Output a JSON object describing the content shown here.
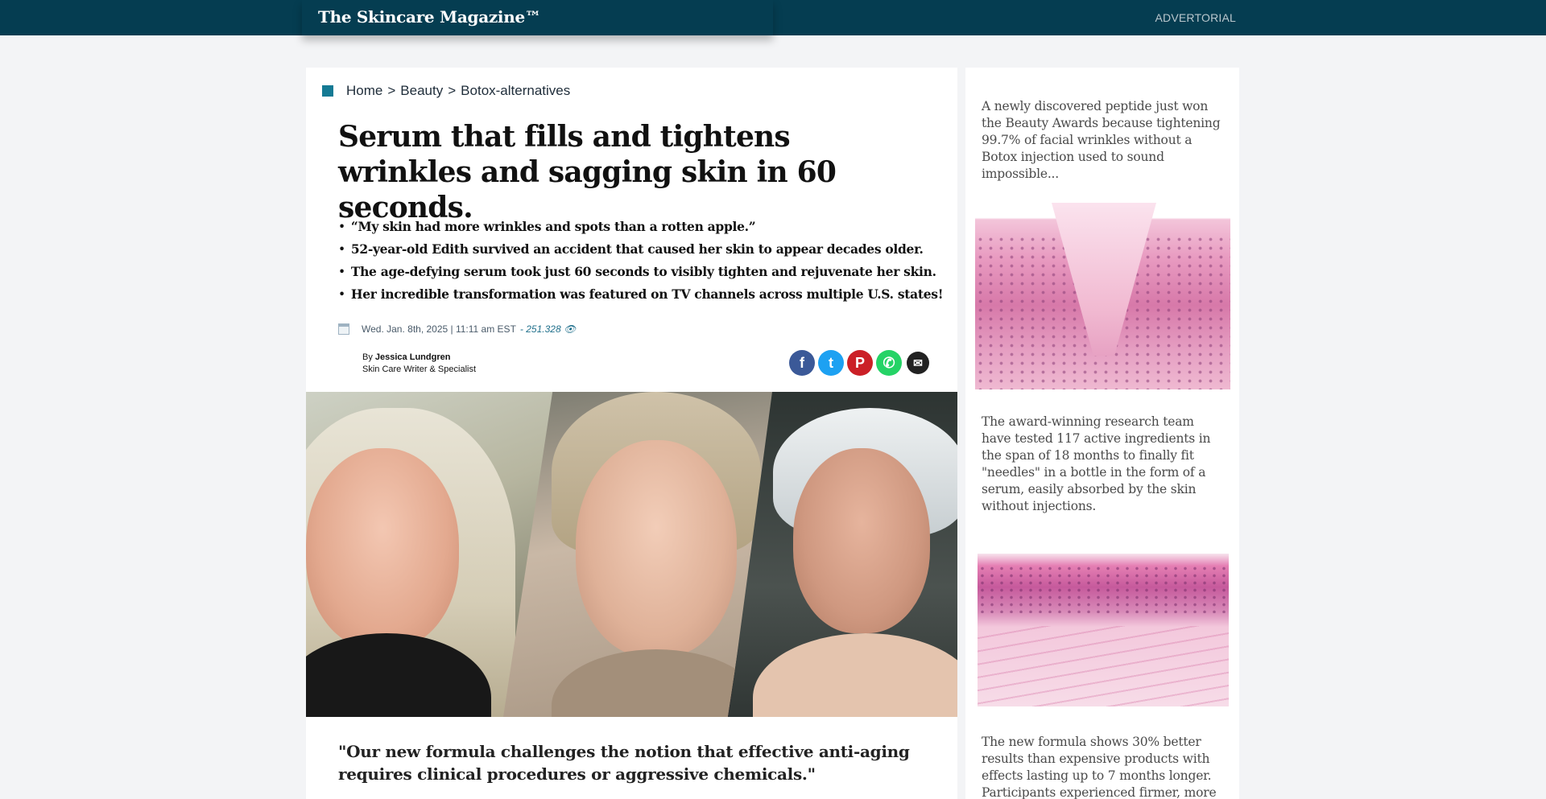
{
  "header": {
    "brand": "The Skincare Magazine™",
    "advertorial_label": "ADVERTORIAL"
  },
  "breadcrumb": {
    "items": [
      "Home",
      "Beauty",
      "Botox-alternatives"
    ],
    "separator": ">"
  },
  "article": {
    "headline": "Serum that fills and tightens wrinkles and sagging skin in 60 seconds.",
    "bullets": [
      "“My skin had more wrinkles and spots than a rotten apple.”",
      "52-year-old Edith survived an accident that caused her skin to appear decades older.",
      "The age-defying serum took just 60 seconds to visibly tighten and rejuvenate her skin.",
      "Her incredible transformation was featured on TV channels across multiple U.S. states!"
    ],
    "date": "Wed. Jan. 8th, 2025 | 11:11 am EST",
    "views": "- 251.328 👁",
    "author_prefix": "By",
    "author_name": "Jessica Lundgren",
    "author_role": "Skin Care Writer & Specialist",
    "quote": "\"Our new formula challenges the notion that effective anti-aging requires clinical procedures or aggressive chemicals.\""
  },
  "share": {
    "facebook": "f",
    "twitter": "t",
    "pinterest": "P",
    "whatsapp": "✆",
    "email": "✉"
  },
  "sidebar": {
    "text1": "A newly discovered peptide just won the Beauty Awards because tightening 99.7% of facial wrinkles without a Botox injection used to sound impossible...",
    "text2": "The award-winning research team have tested 117 active ingredients in the span of 18 months to finally fit \"needles\" in a bottle in the form of a serum, easily absorbed by the skin without injections.",
    "text3": "The new formula shows 30% better results than expensive products with effects lasting up to 7 months longer. Participants experienced firmer, more"
  },
  "colors": {
    "header_bg": "#053d51",
    "accent": "#147a94",
    "facebook": "#3b5998",
    "twitter": "#1da1f2",
    "pinterest": "#cb2027",
    "whatsapp": "#25d366"
  }
}
